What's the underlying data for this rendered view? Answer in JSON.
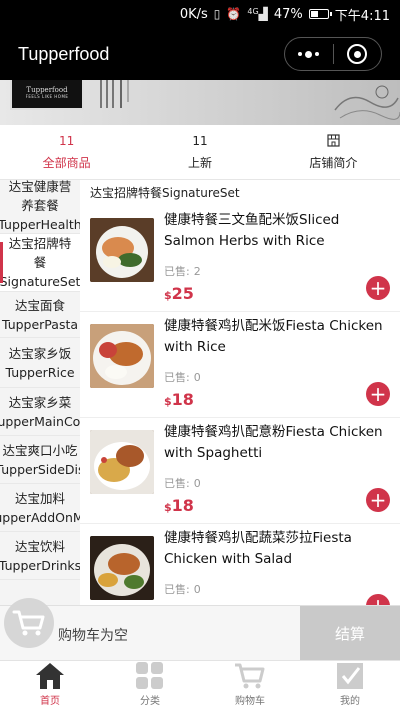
{
  "status_bar": {
    "network_speed": "0K/s",
    "battery": "47%",
    "battery_level": 0.47,
    "time": "下午4:11",
    "signal_label": "4G"
  },
  "title_bar": {
    "title": "Tupperfood"
  },
  "banner": {
    "logo_text": "Tupperfood",
    "logo_tagline": "FEELS LIKE HOME"
  },
  "shop_tabs": [
    {
      "count": "11",
      "label": "全部商品",
      "active": true
    },
    {
      "count": "11",
      "label": "上新",
      "active": false
    },
    {
      "icon": "store-icon",
      "label": "店铺简介",
      "active": false
    }
  ],
  "categories": [
    {
      "label_cn": "达宝健康营养套餐",
      "label_en": "TupperHealth",
      "active": false
    },
    {
      "label_cn": "达宝招牌特餐",
      "label_en": "SignatureSet",
      "active": true
    },
    {
      "label_cn": "达宝面食",
      "label_en": "TupperPasta",
      "active": false
    },
    {
      "label_cn": "达宝家乡饭",
      "label_en": "TupperRice",
      "active": false
    },
    {
      "label_cn": "达宝家乡菜",
      "label_en": "TupperMainCou",
      "active": false
    },
    {
      "label_cn": "达宝爽口小吃",
      "label_en": "TupperSideDis",
      "active": false
    },
    {
      "label_cn": "达宝加料",
      "label_en": "TupperAddOnMe",
      "active": false
    },
    {
      "label_cn": "达宝饮料",
      "label_en": "TupperDrinks",
      "active": false
    }
  ],
  "section_title": "达宝招牌特餐SignatureSet",
  "sold_label": "已售:",
  "currency": "$",
  "products": [
    {
      "name": "健康特餐三文鱼配米饭Sliced Salmon Herbs with Rice",
      "sold": "2",
      "price": "25",
      "image": "salmon-rice-photo"
    },
    {
      "name": "健康特餐鸡扒配米饭Fiesta Chicken with Rice",
      "sold": "0",
      "price": "18",
      "image": "chicken-rice-photo"
    },
    {
      "name": "健康特餐鸡扒配意粉Fiesta Chicken with Spaghetti",
      "sold": "0",
      "price": "18",
      "image": "chicken-spaghetti-photo"
    },
    {
      "name": "健康特餐鸡扒配蔬菜莎拉Fiesta Chicken with Salad",
      "sold": "0",
      "price": "",
      "image": "chicken-salad-photo"
    }
  ],
  "cart": {
    "empty_text": "购物车为空",
    "checkout_label": "结算"
  },
  "bottom_nav": [
    {
      "label": "首页",
      "icon": "home-icon",
      "active": true
    },
    {
      "label": "分类",
      "icon": "category-grid-icon",
      "active": false
    },
    {
      "label": "购物车",
      "icon": "cart-icon",
      "active": false
    },
    {
      "label": "我的",
      "icon": "profile-check-icon",
      "active": false
    }
  ],
  "colors": {
    "accent": "#d0344a",
    "titlebar_bg": "#000000",
    "sidebar_bg": "#f4f4f4",
    "checkout_bg": "#c9c9c9"
  }
}
